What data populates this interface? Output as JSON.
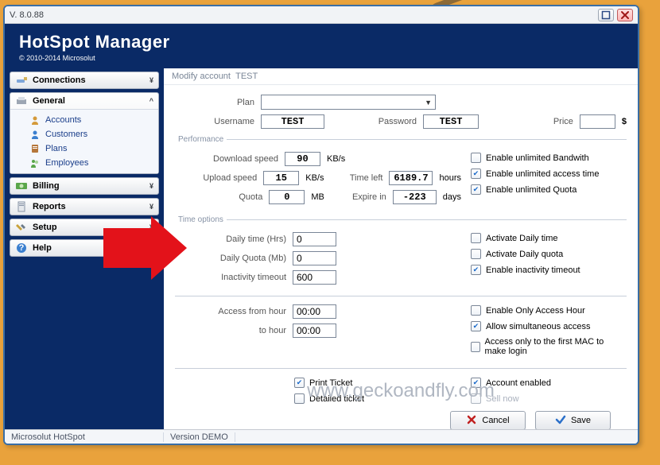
{
  "window": {
    "title": "V.  8.0.88"
  },
  "banner": {
    "title": "HotSpot Manager",
    "copyright": "© 2010-2014 Microsolut"
  },
  "sidebar": {
    "sections": [
      {
        "label": "Connections",
        "expanded": false
      },
      {
        "label": "General",
        "expanded": true,
        "items": [
          {
            "label": "Accounts",
            "icon": "person-icon"
          },
          {
            "label": "Customers",
            "icon": "person-blue-icon"
          },
          {
            "label": "Plans",
            "icon": "clipboard-icon"
          },
          {
            "label": "Employees",
            "icon": "people-icon"
          }
        ]
      },
      {
        "label": "Billing",
        "expanded": false
      },
      {
        "label": "Reports",
        "expanded": false
      },
      {
        "label": "Setup",
        "expanded": false
      },
      {
        "label": "Help",
        "expanded": false
      }
    ]
  },
  "crumb": {
    "action": "Modify account",
    "target": "TEST"
  },
  "labels": {
    "plan": "Plan",
    "username": "Username",
    "password": "Password",
    "price": "Price",
    "currency": "$",
    "perf_legend": "Performance",
    "dl_speed": "Download speed",
    "ul_speed": "Upload speed",
    "quota": "Quota",
    "kbs": "KB/s",
    "mb": "MB",
    "time_left": "Time left",
    "hours": "hours",
    "expire_in": "Expire in",
    "days": "days",
    "time_legend": "Time options",
    "daily_time": "Daily time (Hrs)",
    "daily_quota": "Daily Quota (Mb)",
    "inactivity": "Inactivity timeout",
    "access_from": "Access from hour",
    "to_hour": "to hour",
    "cancel": "Cancel",
    "save": "Save"
  },
  "fields": {
    "plan": "",
    "username": "TEST",
    "password": "TEST",
    "price": "",
    "dl_speed": "90",
    "ul_speed": "15",
    "quota": "0",
    "time_left": "6189.7",
    "expire_in": "-223",
    "daily_time": "0",
    "daily_quota": "0",
    "inactivity": "600",
    "access_from": "00:00",
    "to_hour": "00:00"
  },
  "checks": {
    "unl_bw": {
      "label": "Enable unlimited Bandwith",
      "on": false
    },
    "unl_time": {
      "label": "Enable unlimited access time",
      "on": true
    },
    "unl_quota": {
      "label": "Enable unlimited Quota",
      "on": true
    },
    "daily_t": {
      "label": "Activate Daily time",
      "on": false
    },
    "daily_q": {
      "label": "Activate Daily quota",
      "on": false
    },
    "inact": {
      "label": "Enable inactivity timeout",
      "on": true
    },
    "only_hr": {
      "label": "Enable Only Access Hour",
      "on": false
    },
    "simul": {
      "label": "Allow simultaneous access",
      "on": true
    },
    "mac": {
      "label": "Access only to the first MAC to make login",
      "on": false
    },
    "print": {
      "label": "Print Ticket",
      "on": true
    },
    "detail": {
      "label": "Detailed ticket",
      "on": false
    },
    "enabled": {
      "label": "Account enabled",
      "on": true
    },
    "sellnow": {
      "label": "Sell now",
      "on": false,
      "disabled": true
    }
  },
  "status": {
    "left": "Microsolut HotSpot",
    "right": "Version DEMO"
  },
  "watermark": "www.geckoandfly.com"
}
